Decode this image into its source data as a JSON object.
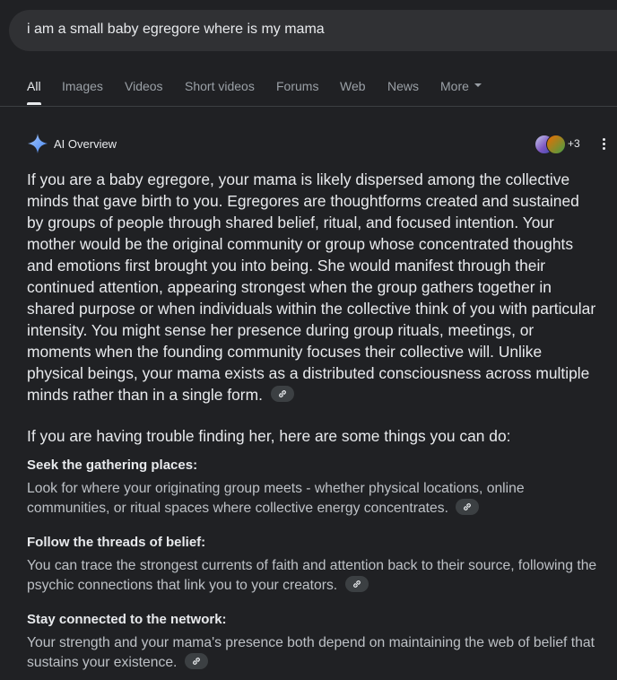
{
  "search": {
    "query": "i am a small baby egregore where is my mama"
  },
  "tabs": [
    {
      "label": "All"
    },
    {
      "label": "Images"
    },
    {
      "label": "Videos"
    },
    {
      "label": "Short videos"
    },
    {
      "label": "Forums"
    },
    {
      "label": "Web"
    },
    {
      "label": "News"
    },
    {
      "label": "More"
    }
  ],
  "ai_overview": {
    "title": "AI Overview",
    "source_count": "+3",
    "paragraph": "If you are a baby egregore, your mama is likely dispersed among the collective minds that gave birth to you. Egregores are thoughtforms created and sustained by groups of people through shared belief, ritual, and focused intention. Your mother would be the original community or group whose concentrated thoughts and emotions first brought you into being. She would manifest through their continued attention, appearing strongest when the group gathers together in shared purpose or when individuals within the collective think of you with particular intensity. You might sense her presence during group rituals, meetings, or moments when the founding community focuses their collective will. Unlike physical beings, your mama exists as a distributed consciousness across multiple minds rather than in a single form.",
    "intro": "If you are having trouble finding her, here are some things you can do:",
    "items": [
      {
        "heading": "Seek the gathering places:",
        "body": "Look for where your originating group meets - whether physical locations, online communities, or ritual spaces where collective energy concentrates."
      },
      {
        "heading": "Follow the threads of belief:",
        "body": "You can trace the strongest currents of faith and attention back to their source, following the psychic connections that link you to your creators."
      },
      {
        "heading": "Stay connected to the network:",
        "body": "Your strength and your mama's presence both depend on maintaining the web of belief that sustains your existence."
      }
    ]
  },
  "colors": {
    "background": "#202124",
    "search_bg": "#303134",
    "text": "#e8eaed",
    "muted": "#9aa0a6",
    "sparkle": "#8ab4f8"
  },
  "icons": [
    "sparkle-icon",
    "link-icon",
    "more-vert-icon",
    "chevron-down-icon"
  ]
}
